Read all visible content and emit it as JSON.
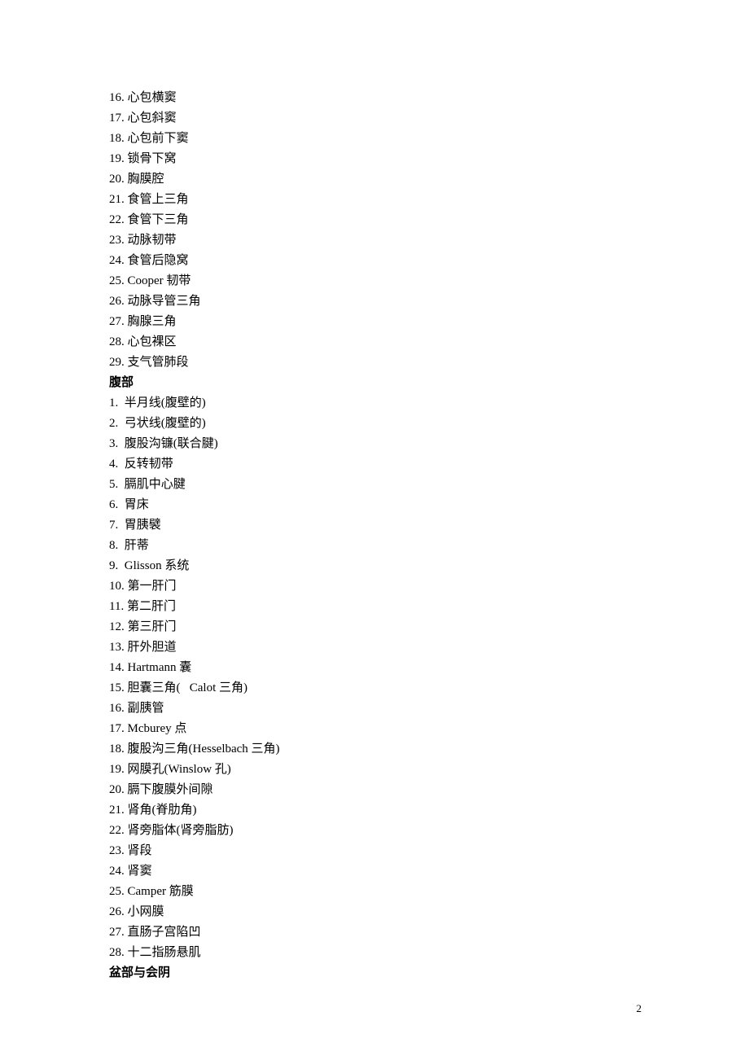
{
  "section1_items": [
    "16. 心包横窦",
    "17. 心包斜窦",
    "18. 心包前下窦",
    "19. 锁骨下窝",
    "20. 胸膜腔",
    "21. 食管上三角",
    "22. 食管下三角",
    "23. 动脉韧带",
    "24. 食管后隐窝",
    "25. Cooper 韧带",
    "26. 动脉导管三角",
    "27. 胸腺三角",
    "28. 心包裸区",
    "29. 支气管肺段"
  ],
  "heading1": "腹部",
  "section2_items": [
    "1.  半月线(腹壁的)",
    "2.  弓状线(腹壁的)",
    "3.  腹股沟镰(联合腱)",
    "4.  反转韧带",
    "5.  膈肌中心腱",
    "6.  胃床",
    "7.  胃胰襞",
    "8.  肝蒂",
    "9.  Glisson 系统",
    "10. 第一肝门",
    "11. 第二肝门",
    "12. 第三肝门",
    "13. 肝外胆道",
    "14. Hartmann 囊",
    "15. 胆囊三角(   Calot 三角)",
    "16. 副胰管",
    "17. Mcburey 点",
    "18. 腹股沟三角(Hesselbach 三角)",
    "19. 网膜孔(Winslow 孔)",
    "20. 膈下腹膜外间隙",
    "21. 肾角(脊肋角)",
    "22. 肾旁脂体(肾旁脂肪)",
    "23. 肾段",
    "24. 肾窦",
    "25. Camper 筋膜",
    "26. 小网膜",
    "27. 直肠子宫陷凹",
    "28. 十二指肠悬肌"
  ],
  "heading2": "盆部与会阴",
  "page_number": "2"
}
